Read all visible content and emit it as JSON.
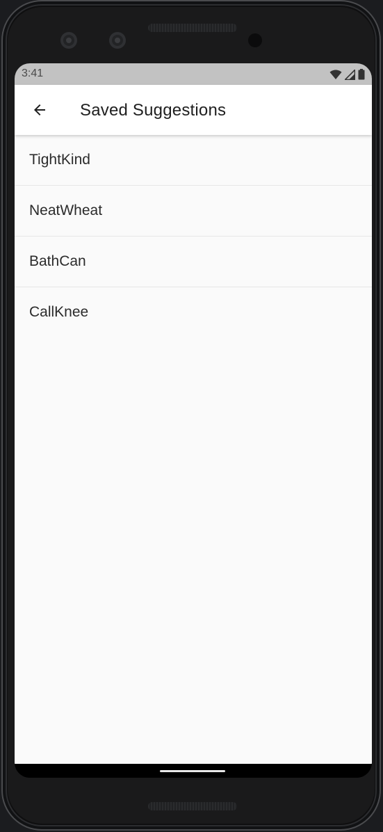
{
  "status_bar": {
    "time": "3:41",
    "icons": [
      "wifi-icon",
      "signal-icon",
      "battery-icon"
    ]
  },
  "app_bar": {
    "back_icon": "arrow-back-icon",
    "title": "Saved Suggestions"
  },
  "saved_list": {
    "items": [
      {
        "label": "TightKind"
      },
      {
        "label": "NeatWheat"
      },
      {
        "label": "BathCan"
      },
      {
        "label": "CallKnee"
      }
    ]
  },
  "colors": {
    "status_bar": "#c2c2c2",
    "app_bar": "#ffffff",
    "background": "#fafafa",
    "text": "#2b2b2b"
  }
}
